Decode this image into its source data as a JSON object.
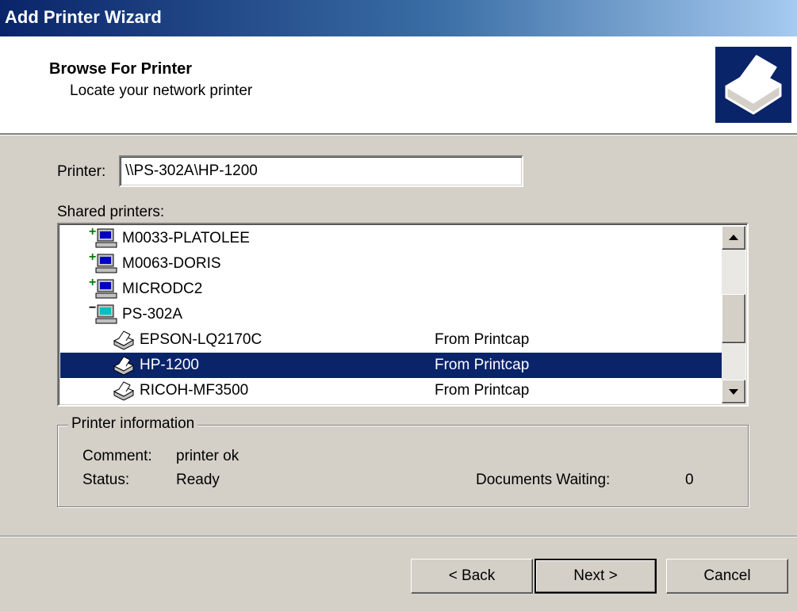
{
  "window": {
    "title": "Add Printer Wizard"
  },
  "header": {
    "title": "Browse For Printer",
    "subtitle": "Locate your network printer",
    "icon": "printer-wizard-icon"
  },
  "printer_field": {
    "label": "Printer:",
    "value": "\\\\PS-302A\\HP-1200"
  },
  "shared_printers": {
    "label": "Shared printers:",
    "rows": [
      {
        "type": "computer",
        "state": "collapsed",
        "name": "M0033-PLATOLEE",
        "comment": ""
      },
      {
        "type": "computer",
        "state": "collapsed",
        "name": "M0063-DORIS",
        "comment": ""
      },
      {
        "type": "computer",
        "state": "collapsed",
        "name": "MICRODC2",
        "comment": ""
      },
      {
        "type": "computer",
        "state": "expanded",
        "name": "PS-302A",
        "comment": ""
      },
      {
        "type": "printer",
        "name": "EPSON-LQ2170C",
        "comment": "From Printcap"
      },
      {
        "type": "printer",
        "name": "HP-1200",
        "comment": "From Printcap",
        "selected": true
      },
      {
        "type": "printer",
        "name": "RICOH-MF3500",
        "comment": "From Printcap"
      }
    ]
  },
  "printer_info": {
    "legend": "Printer information",
    "comment_label": "Comment:",
    "comment_value": "printer ok",
    "status_label": "Status:",
    "status_value": "Ready",
    "docs_label": "Documents Waiting:",
    "docs_value": "0"
  },
  "buttons": {
    "back": "< Back",
    "next": "Next >",
    "cancel": "Cancel"
  },
  "colors": {
    "selection": "#0a246a",
    "face": "#d4d0c8",
    "title_start": "#0a246a"
  }
}
